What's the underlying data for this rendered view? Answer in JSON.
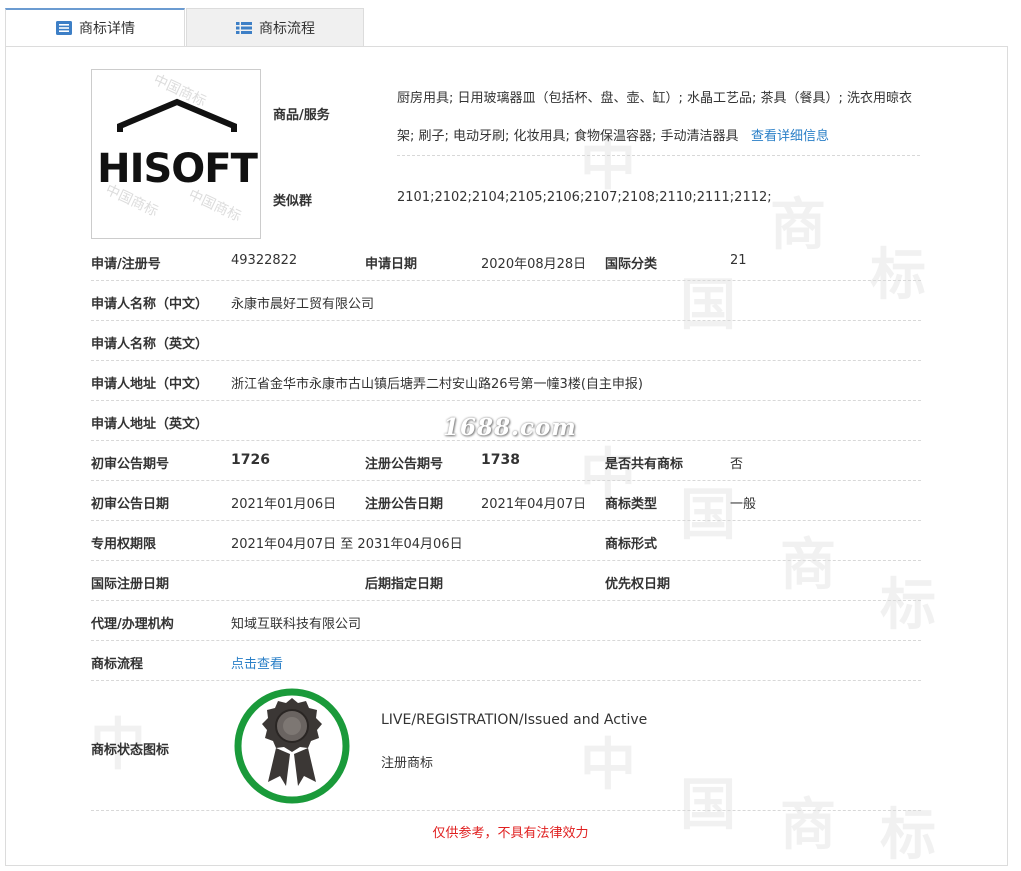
{
  "tabs": [
    {
      "label": "商标详情",
      "icon": "document-list-icon"
    },
    {
      "label": "商标流程",
      "icon": "list-icon"
    }
  ],
  "logo": {
    "text": "HISOFT",
    "watermark_text": "中国商标"
  },
  "goods": {
    "label": "商品/服务",
    "text": "厨房用具; 日用玻璃器皿（包括杯、盘、壶、缸）; 水晶工艺品; 茶具（餐具）; 洗衣用晾衣架; 刷子; 电动牙刷; 化妆用具; 食物保温容器; 手动清洁器具",
    "more_link": "查看详细信息"
  },
  "similar_groups": {
    "label": "类似群",
    "value": "2101;2102;2104;2105;2106;2107;2108;2110;2111;2112;"
  },
  "rows": {
    "reg_no": {
      "label": "申请/注册号",
      "value": "49322822"
    },
    "apply_date": {
      "label": "申请日期",
      "value": "2020年08月28日"
    },
    "intl_class": {
      "label": "国际分类",
      "value": "21"
    },
    "applicant_cn": {
      "label": "申请人名称（中文）",
      "value": "永康市晨好工贸有限公司"
    },
    "applicant_en": {
      "label": "申请人名称（英文）",
      "value": ""
    },
    "address_cn": {
      "label": "申请人地址（中文）",
      "value": "浙江省金华市永康市古山镇后塘弄二村安山路26号第一幢3楼(自主申报)"
    },
    "address_en": {
      "label": "申请人地址（英文）",
      "value": ""
    },
    "prelim_no": {
      "label": "初审公告期号",
      "value": "1726"
    },
    "reg_pub_no": {
      "label": "注册公告期号",
      "value": "1738"
    },
    "shared": {
      "label": "是否共有商标",
      "value": "否"
    },
    "prelim_date": {
      "label": "初审公告日期",
      "value": "2021年01月06日"
    },
    "reg_pub_date": {
      "label": "注册公告日期",
      "value": "2021年04月07日"
    },
    "mark_type": {
      "label": "商标类型",
      "value": "一般"
    },
    "exclusive_period": {
      "label": "专用权期限",
      "value": "2021年04月07日 至 2031年04月06日"
    },
    "mark_form": {
      "label": "商标形式",
      "value": ""
    },
    "intl_reg_date": {
      "label": "国际注册日期",
      "value": ""
    },
    "later_designation": {
      "label": "后期指定日期",
      "value": ""
    },
    "priority_date": {
      "label": "优先权日期",
      "value": ""
    },
    "agent": {
      "label": "代理/办理机构",
      "value": "知域互联科技有限公司"
    },
    "process": {
      "label": "商标流程",
      "value": "点击查看"
    }
  },
  "status": {
    "label": "商标状态图标",
    "line1": "LIVE/REGISTRATION/Issued and Active",
    "line2": "注册商标",
    "ring_color": "#1a9a3a",
    "icon": "award-ribbon-icon"
  },
  "watermark_site": "1688.com",
  "disclaimer": "仅供参考，不具有法律效力"
}
